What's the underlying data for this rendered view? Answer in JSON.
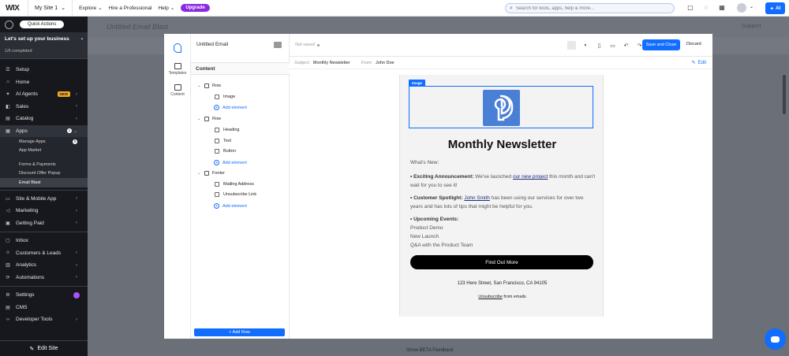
{
  "topbar": {
    "logo": "WIX",
    "site_name": "My Site 1",
    "links": [
      "Explore",
      "Hire a Professional",
      "Help"
    ],
    "upgrade": "Upgrade",
    "search_placeholder": "Search for tools, apps, help & more...",
    "ai_label": "AI"
  },
  "sidebar": {
    "quick_actions": "Quick Actions",
    "setup_title": "Let's set up your business",
    "setup_progress": "1/6 completed",
    "items": [
      {
        "label": "Setup"
      },
      {
        "label": "Home"
      },
      {
        "label": "AI Agents",
        "badge": "NEW"
      },
      {
        "label": "Sales"
      },
      {
        "label": "Catalog"
      },
      {
        "label": "Apps",
        "badge": "1"
      }
    ],
    "apps_sub": [
      {
        "label": "Manage Apps",
        "badge": "5"
      },
      {
        "label": "App Market"
      },
      {
        "label": "Forms & Payments"
      },
      {
        "label": "Discount Offer Popup"
      },
      {
        "label": "Email Blast"
      }
    ],
    "items2": [
      {
        "label": "Site & Mobile App"
      },
      {
        "label": "Marketing"
      },
      {
        "label": "Getting Paid"
      }
    ],
    "items3": [
      {
        "label": "Inbox"
      },
      {
        "label": "Customers & Leads"
      },
      {
        "label": "Analytics"
      },
      {
        "label": "Automations"
      }
    ],
    "items4": [
      {
        "label": "Settings"
      },
      {
        "label": "CMS"
      },
      {
        "label": "Developer Tools"
      }
    ],
    "edit_site": "Edit Site"
  },
  "background": {
    "title": "Untitled Email Blast",
    "support": "Support",
    "footer_link": "Show BETA Feedback"
  },
  "editor": {
    "rail": {
      "templates": "Templates",
      "content": "Content"
    },
    "email_name": "Untitled Email",
    "panel_title": "Content",
    "tree": {
      "row1": "Row",
      "row1_el": [
        "Image"
      ],
      "row2": "Row",
      "row2_el": [
        "Heading",
        "Text",
        "Button"
      ],
      "footer": "Footer",
      "footer_el": [
        "Mailing Address",
        "Unsubscribe Link"
      ],
      "add_element": "Add element"
    },
    "add_row": "+ Add Row",
    "not_saved": "Not saved",
    "save_close": "Save and Close",
    "discard": "Discard",
    "subject_label": "Subject:",
    "subject_value": "Monthly Newsletter",
    "from_label": "From:",
    "from_value": "John Doe",
    "edit": "Edit"
  },
  "email": {
    "image_tag": "Image",
    "title": "Monthly Newsletter",
    "whats_new": "What's New:",
    "p1_bold": "• Exciting Announcement:",
    "p1_pre": " We've launched ",
    "p1_link": "our new project",
    "p1_post": " this month and can't wait for you to see it!",
    "p2_bold": "• Customer Spotlight:",
    "p2_link": "John Smith",
    "p2_post": " has been using our services for over two years and has lots of tips that might be helpful for you.",
    "p3_bold": "• Upcoming Events:",
    "events": [
      "Product Demo",
      "New Launch",
      "Q&A with the Product Team"
    ],
    "cta": "Find Out More",
    "address": "123 Here Street, San Francisco, CA 94105",
    "unsub_link": "Unsubscribe",
    "unsub_rest": " from emails"
  },
  "colors": {
    "accent": "#116dff",
    "sidebar": "#16181d",
    "upgrade": "#8a2be2"
  }
}
